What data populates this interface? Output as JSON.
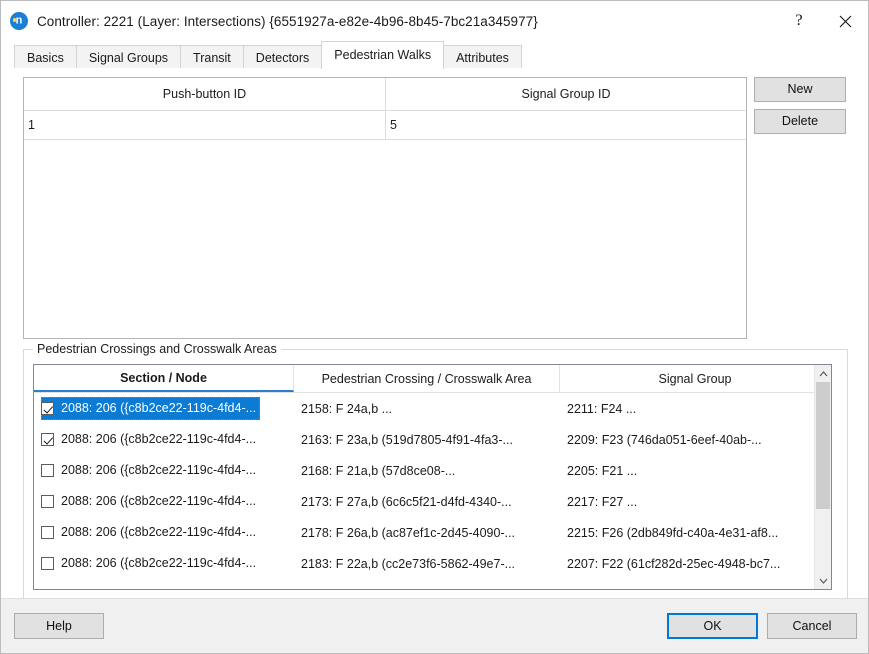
{
  "window": {
    "title": "Controller: 2221 (Layer: Intersections) {6551927a-e82e-4b96-8b45-7bc21a345977}",
    "icon": "app-n-icon",
    "help_button": "?",
    "close_button": "✕",
    "accent_color": "#0078d7",
    "selection_color": "#0b7bd4"
  },
  "tabs": [
    {
      "label": "Basics",
      "active": false
    },
    {
      "label": "Signal Groups",
      "active": false
    },
    {
      "label": "Transit",
      "active": false
    },
    {
      "label": "Detectors",
      "active": false
    },
    {
      "label": "Pedestrian Walks",
      "active": true
    },
    {
      "label": "Attributes",
      "active": false
    }
  ],
  "push_button_grid": {
    "columns": [
      "Push-button ID",
      "Signal Group ID"
    ],
    "rows": [
      {
        "push_button_id": "1",
        "signal_group_id": "5"
      }
    ]
  },
  "side_buttons": {
    "new_label": "New",
    "delete_label": "Delete"
  },
  "crossings_group": {
    "title": "Pedestrian Crossings and Crosswalk Areas",
    "columns": [
      "Section / Node",
      "Pedestrian Crossing / Crosswalk Area",
      "Signal Group"
    ],
    "sorted_column": "Section / Node",
    "rows": [
      {
        "checked": true,
        "selected": true,
        "section_node": "2088: 206 ({c8b2ce22-119c-4fd4-...",
        "crossing": "2158: F 24a,b ...",
        "signal_group": "2211: F24 ..."
      },
      {
        "checked": true,
        "selected": false,
        "section_node": "2088: 206 ({c8b2ce22-119c-4fd4-...",
        "crossing": "2163: F 23a,b (519d7805-4f91-4fa3-...",
        "signal_group": "2209: F23 (746da051-6eef-40ab-..."
      },
      {
        "checked": false,
        "selected": false,
        "section_node": "2088: 206 ({c8b2ce22-119c-4fd4-...",
        "crossing": "2168: F 21a,b (57d8ce08-...",
        "signal_group": "2205: F21 ..."
      },
      {
        "checked": false,
        "selected": false,
        "section_node": "2088: 206 ({c8b2ce22-119c-4fd4-...",
        "crossing": "2173: F 27a,b (6c6c5f21-d4fd-4340-...",
        "signal_group": "2217: F27 ..."
      },
      {
        "checked": false,
        "selected": false,
        "section_node": "2088: 206 ({c8b2ce22-119c-4fd4-...",
        "crossing": "2178: F 26a,b (ac87ef1c-2d45-4090-...",
        "signal_group": "2215: F26 (2db849fd-c40a-4e31-af8..."
      },
      {
        "checked": false,
        "selected": false,
        "section_node": "2088: 206 ({c8b2ce22-119c-4fd4-...",
        "crossing": "2183: F 22a,b (cc2e73f6-5862-49e7-...",
        "signal_group": "2207: F22 (61cf282d-25ec-4948-bc7..."
      }
    ]
  },
  "footer": {
    "help_label": "Help",
    "ok_label": "OK",
    "cancel_label": "Cancel"
  }
}
